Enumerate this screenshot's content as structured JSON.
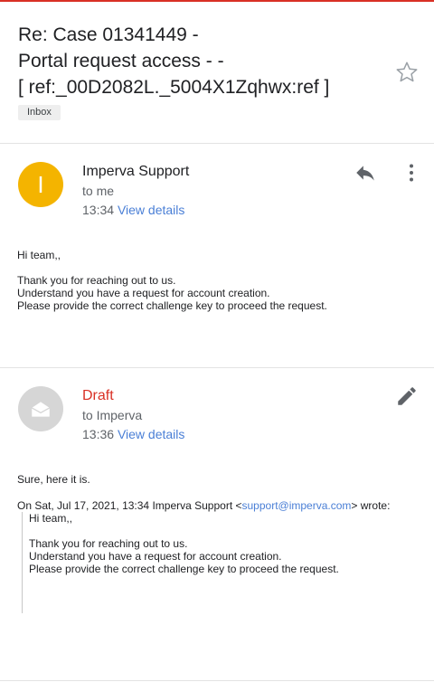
{
  "thread": {
    "subject_lines": [
      "Re: Case 01341449 -",
      "Portal request access - -",
      "[ ref:_00D2082L._5004X1Zqhwx:ref ]"
    ],
    "label": "Inbox",
    "star_icon": "star-outline-icon"
  },
  "messages": [
    {
      "avatar_letter": "I",
      "avatar_color": "#f4b400",
      "sender": "Imperva Support",
      "to": "to me",
      "time": "13:34",
      "view_details": "View details",
      "actions": [
        "reply-icon",
        "more-vert-icon"
      ],
      "body": [
        "Hi team,,",
        "",
        "Thank you for reaching out to us.",
        "Understand you have a request for account creation.",
        "Please provide the correct challenge key to proceed the request."
      ]
    },
    {
      "avatar_icon": "draft-envelope-icon",
      "sender": "Draft",
      "sender_color": "#d93025",
      "to": "to Imperva",
      "time": "13:36",
      "view_details": "View details",
      "actions": [
        "edit-pencil-icon"
      ],
      "body": [
        "Sure, here it is."
      ],
      "quote": {
        "header_prefix": "On Sat, Jul 17, 2021, 13:34 Imperva Support <",
        "header_email": "support@imperva.com",
        "header_suffix": "> wrote:",
        "lines": [
          "Hi team,,",
          "",
          "Thank you for reaching out to us.",
          "Understand you have a request for account creation.",
          "Please provide the correct challenge key to proceed the request."
        ]
      }
    }
  ]
}
